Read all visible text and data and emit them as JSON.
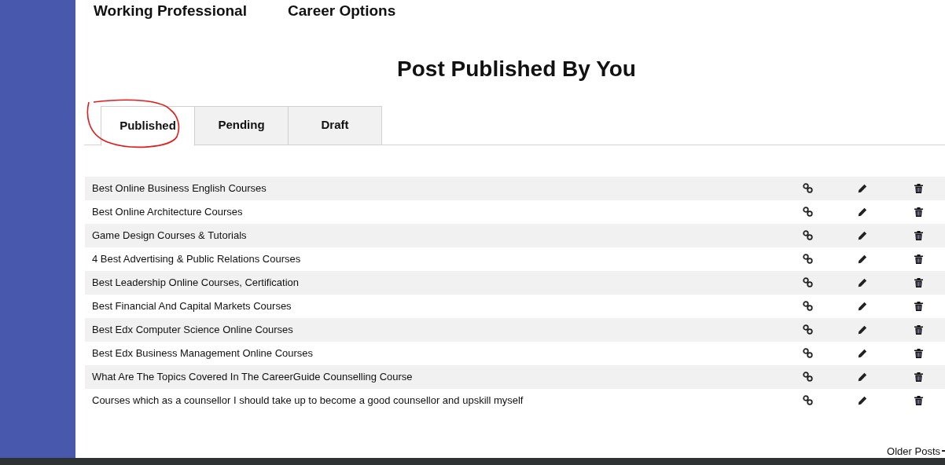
{
  "nav": [
    "Working Professional",
    "Career Options"
  ],
  "title": "Post Published By You",
  "tabs": [
    {
      "label": "Published",
      "selected": true
    },
    {
      "label": "Pending",
      "selected": false
    },
    {
      "label": "Draft",
      "selected": false
    }
  ],
  "posts": [
    "Best Online Business English Courses",
    "Best Online Architecture Courses",
    "Game Design Courses & Tutorials",
    "4 Best Advertising & Public Relations Courses",
    "Best Leadership Online Courses, Certification",
    "Best Financial And Capital Markets Courses",
    "Best Edx Computer Science Online Courses",
    "Best Edx Business Management Online Courses",
    "What Are The Topics Covered In The CareerGuide Counselling Course",
    "Courses which as a counsellor I should take up to become a good counsellor and upskill myself"
  ],
  "pager": {
    "label": "Older Posts"
  }
}
